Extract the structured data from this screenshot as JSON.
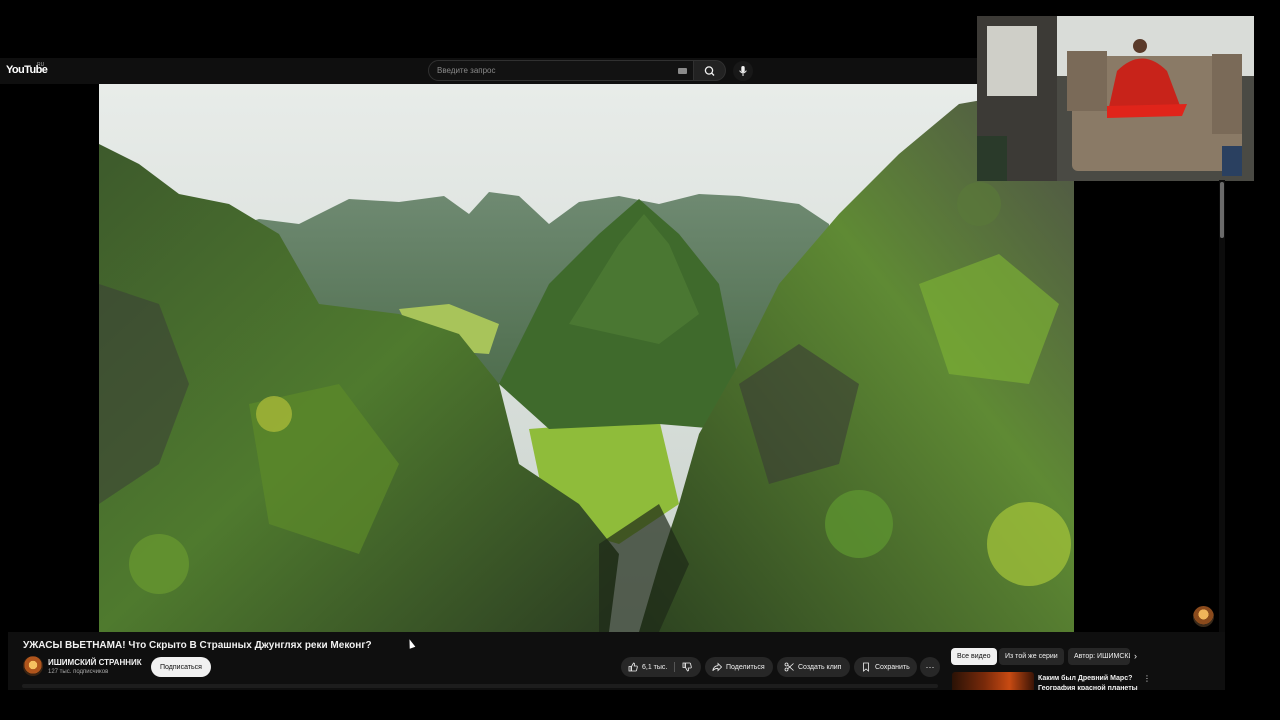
{
  "masthead": {
    "logo_text": "YouTube",
    "logo_country": "RU",
    "search_placeholder": "Введите запрос",
    "icons": [
      "keyboard-icon",
      "search-icon",
      "microphone-icon"
    ]
  },
  "video": {
    "title": "УЖАСЫ ВЬЕТНАМА! Что Скрыто В Страшных Джунглях реки Меконг?",
    "scene": "aerial view of green karst mountains and valley"
  },
  "channel": {
    "name": "ИШИМСКИЙ СТРАННИК",
    "subscribers": "127 тыс. подписчиков",
    "subscribe_label": "Подписаться"
  },
  "actions": {
    "likes": "6,1 тыс.",
    "share": "Поделиться",
    "clip": "Создать клип",
    "save": "Сохранить",
    "more": "···"
  },
  "chips": {
    "all": "Все видео",
    "series": "Из той же серии",
    "author": "Автор: ИШИМСКИЙ СТРАННИК",
    "next": "›"
  },
  "recommendation": {
    "title": "Каким был Древний Марс? География красной планеты",
    "more": "⋮"
  },
  "colors": {
    "background": "#0f0f0f",
    "chip_active": "#f1f1f1",
    "pill": "#272727",
    "text": "#f1f1f1",
    "muted": "#aaaaaa"
  }
}
